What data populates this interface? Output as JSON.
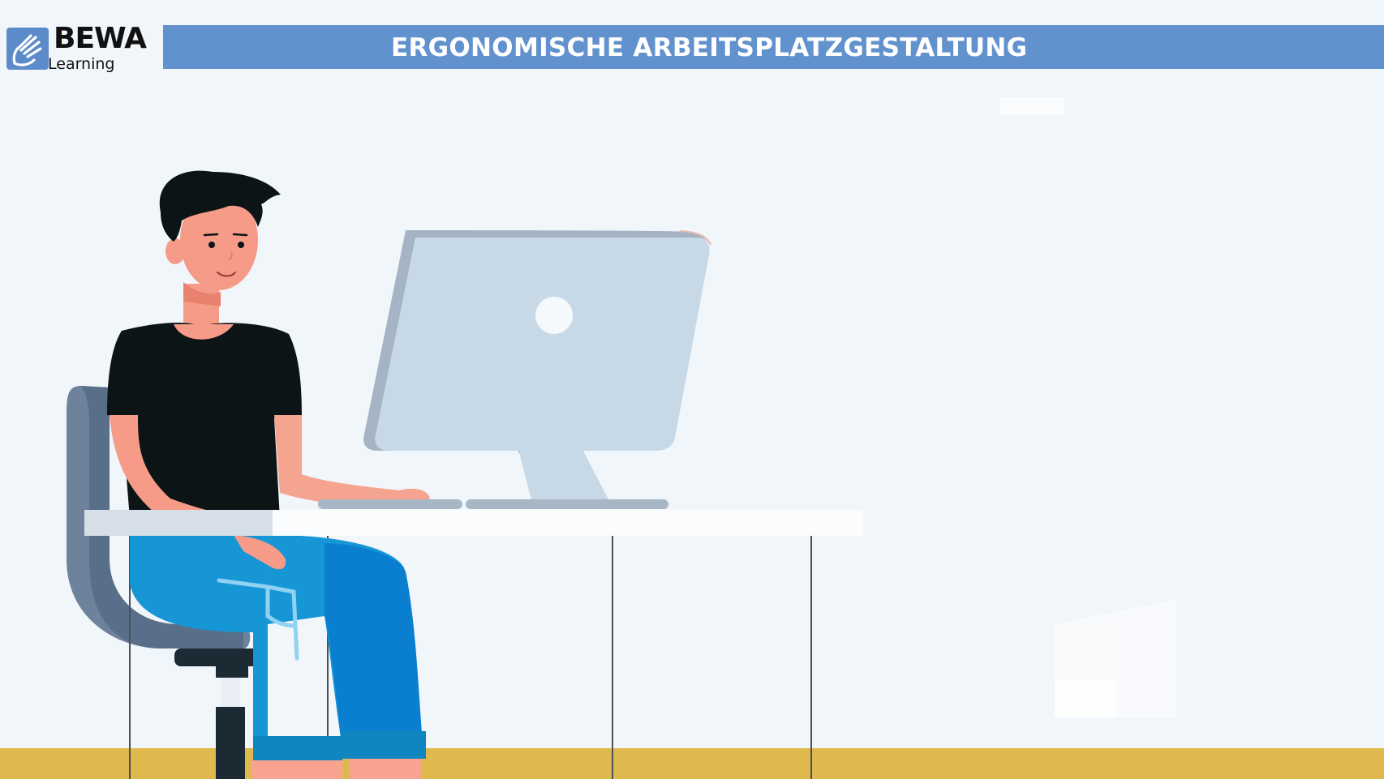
{
  "header": {
    "logo_word": "BEWA",
    "logo_sub": "Learning",
    "title": "ERGONOMISCHE ARBEITSPLATZGESTALTUNG"
  },
  "icons": {
    "logo": "waving-hand-logo-icon",
    "person": "seated-person-illustration",
    "monitor": "desktop-monitor-icon",
    "chair": "office-chair-icon",
    "desk": "desk-illustration"
  },
  "colors": {
    "title_bar": "#6192cd",
    "background": "#f1f6fa",
    "floor": "#dfb94e",
    "shirt": "#0d1416",
    "jeans": "#1796d6",
    "monitor": "#c7d8e7"
  }
}
